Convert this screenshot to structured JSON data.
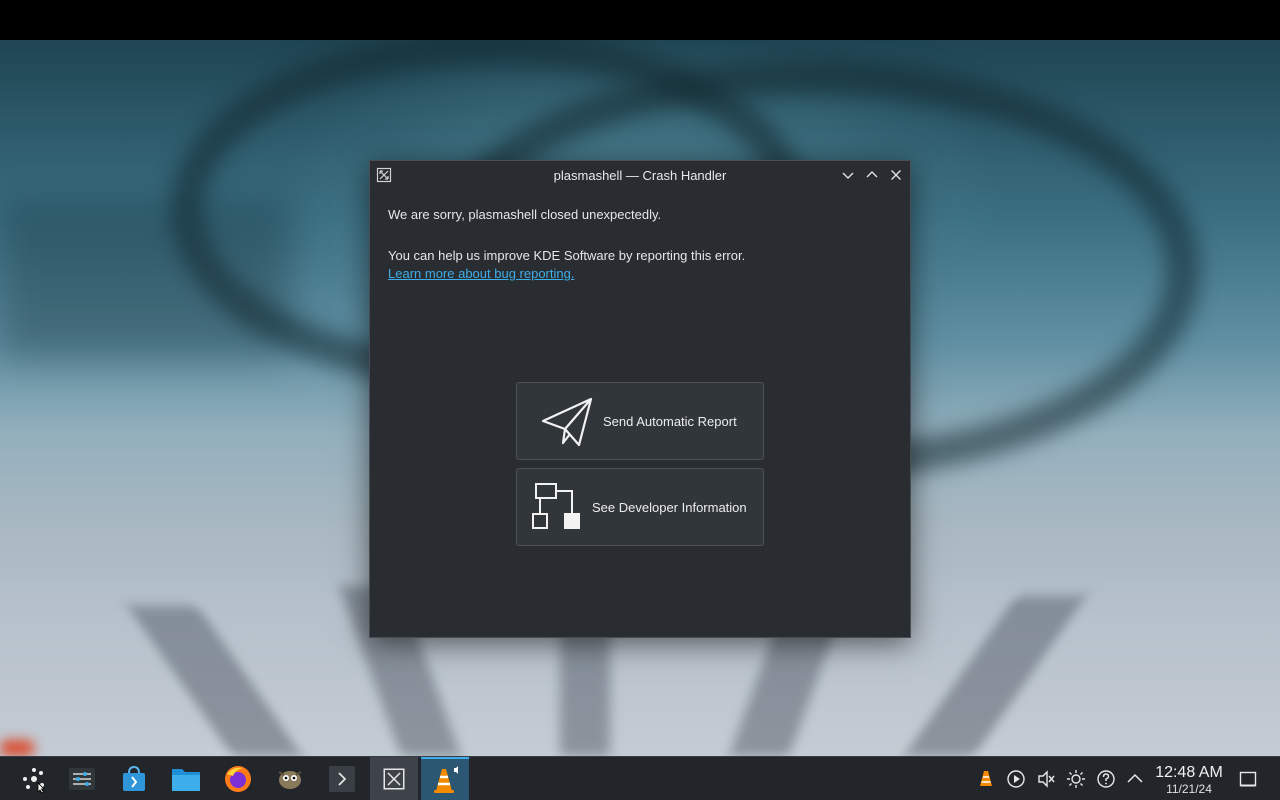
{
  "window": {
    "title": "plasmashell — Crash Handler",
    "message": "We are sorry, plasmashell closed unexpectedly.",
    "help_text": "You can help us improve KDE Software by reporting this error.",
    "learn_more_link": "Learn more about bug reporting.",
    "buttons": {
      "send_report": "Send Automatic Report",
      "developer_info": "See Developer Information"
    },
    "controls": [
      "minimize-icon",
      "maximize-icon",
      "close-icon"
    ]
  },
  "taskbar": {
    "launchers": [
      "application-launcher-icon",
      "system-settings-icon",
      "discover-store-icon",
      "file-manager-icon",
      "firefox-icon",
      "gimp-icon",
      "terminal-icon",
      "crash-handler-task-icon",
      "vlc-task-icon"
    ],
    "tray": [
      "vlc-tray-icon",
      "media-player-icon",
      "volume-muted-icon",
      "brightness-icon",
      "help-icon",
      "tray-expand-icon"
    ],
    "clock": {
      "time": "12:48 AM",
      "date": "11/21/24"
    },
    "show_desktop": "show-desktop-icon"
  },
  "colors": {
    "window_bg": "#292c30",
    "button_bg": "#31363b",
    "link": "#3daee9",
    "taskbar_bg": "#22262b"
  }
}
